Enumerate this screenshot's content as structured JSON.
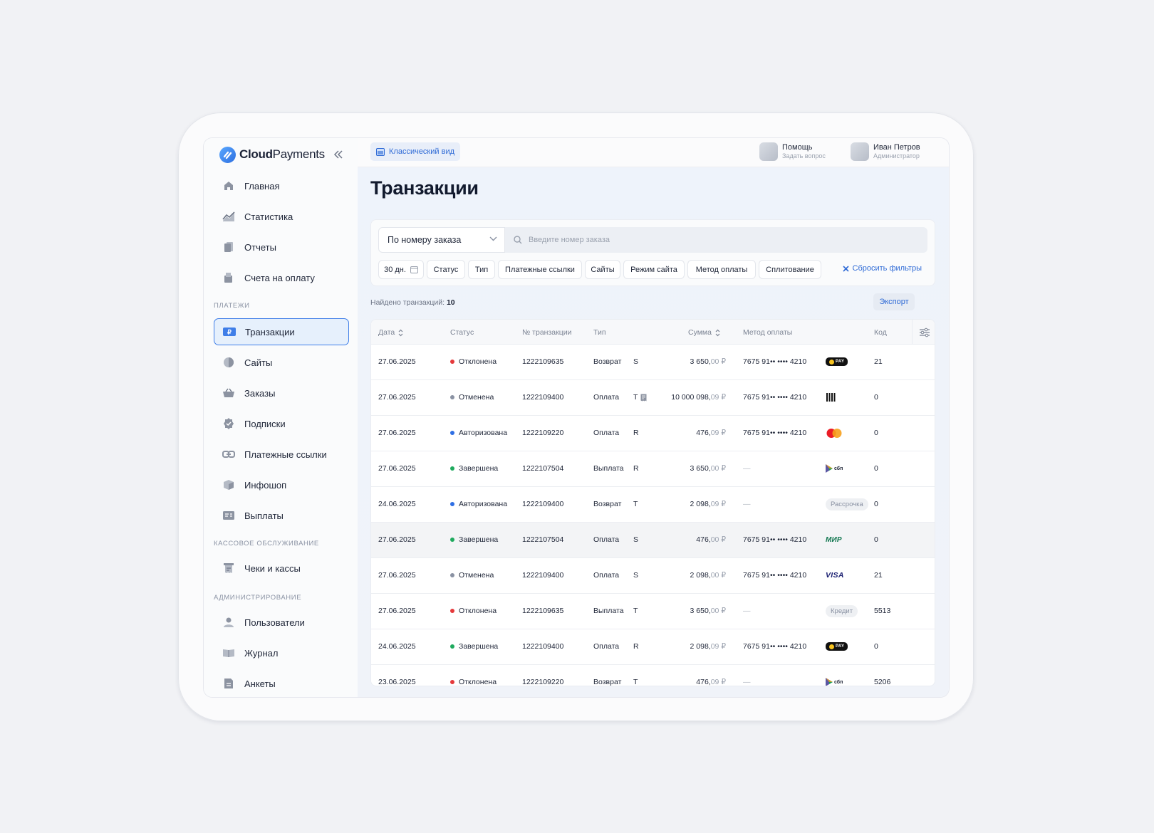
{
  "app": {
    "brand_bold": "Cloud",
    "brand_regular": "Payments"
  },
  "sidebar": {
    "items_top": [
      {
        "label": "Главная",
        "icon": "home-icon"
      },
      {
        "label": "Статистика",
        "icon": "chart-icon"
      },
      {
        "label": "Отчеты",
        "icon": "reports-icon"
      },
      {
        "label": "Счета на оплату",
        "icon": "invoice-icon"
      }
    ],
    "section_payments": "ПЛАТЕЖИ",
    "items_payments": [
      {
        "label": "Транзакции",
        "icon": "transactions-icon",
        "active": true
      },
      {
        "label": "Сайты",
        "icon": "globe-icon"
      },
      {
        "label": "Заказы",
        "icon": "basket-icon"
      },
      {
        "label": "Подписки",
        "icon": "badge-check-icon"
      },
      {
        "label": "Платежные ссылки",
        "icon": "link-icon"
      },
      {
        "label": "Инфошоп",
        "icon": "box-icon"
      },
      {
        "label": "Выплаты",
        "icon": "payout-icon"
      }
    ],
    "section_cash": "КАССОВОЕ ОБСЛУЖИВАНИЕ",
    "items_cash": [
      {
        "label": "Чеки и кассы",
        "icon": "receipt-icon"
      }
    ],
    "section_admin": "АДМИНИСТРИРОВАНИЕ",
    "items_admin": [
      {
        "label": "Пользователи",
        "icon": "users-icon"
      },
      {
        "label": "Журнал",
        "icon": "book-icon"
      },
      {
        "label": "Анкеты",
        "icon": "form-icon"
      }
    ]
  },
  "topbar": {
    "classic_label": "Классический вид",
    "help_title": "Помощь",
    "help_sub": "Задать вопрос",
    "user_name": "Иван Петров",
    "user_role": "Администратор"
  },
  "page": {
    "title": "Транзакции"
  },
  "filters": {
    "search_by": "По номеру заказа",
    "search_placeholder": "Введите номер заказа",
    "chips": [
      "30 дн.",
      "Статус",
      "Тип",
      "Платежные ссылки",
      "Сайты",
      "Режим сайта",
      "Метод оплаты",
      "Сплитование"
    ],
    "reset_label": "Сбросить фильтры"
  },
  "results": {
    "found_label": "Найдено транзакций:",
    "found_count": "10",
    "export_label": "Экспорт"
  },
  "table": {
    "columns": [
      "Дата",
      "Статус",
      "№ транзакции",
      "Тип",
      "Сумма",
      "Метод оплаты",
      "Код"
    ],
    "rows": [
      {
        "date": "27.06.2025",
        "status": "Отклонена",
        "status_color": "#e5393b",
        "id": "1222109635",
        "type": "Возврат",
        "letter": "S",
        "receipt": false,
        "amount_int": "3 650,",
        "amount_dec": "00 ₽",
        "card": "7675 91•• •••• 4210",
        "method": "yandex-pay-icon",
        "method_text": "PAY",
        "code": "21"
      },
      {
        "date": "27.06.2025",
        "status": "Отменена",
        "status_color": "#8a92a3",
        "id": "1222109400",
        "type": "Оплата",
        "letter": "T",
        "receipt": true,
        "amount_int": "10 000 098,",
        "amount_dec": "09 ₽",
        "card": "7675 91•• •••• 4210",
        "method": "barcode-icon",
        "method_text": "",
        "code": "0"
      },
      {
        "date": "27.06.2025",
        "status": "Авторизована",
        "status_color": "#2f6fe4",
        "id": "1222109220",
        "type": "Оплата",
        "letter": "R",
        "receipt": false,
        "amount_int": "476,",
        "amount_dec": "09 ₽",
        "card": "7675 91•• •••• 4210",
        "method": "mastercard-icon",
        "method_text": "",
        "code": "0"
      },
      {
        "date": "27.06.2025",
        "status": "Завершена",
        "status_color": "#1faa5e",
        "id": "1222107504",
        "type": "Выплата",
        "letter": "R",
        "receipt": false,
        "amount_int": "3 650,",
        "amount_dec": "00 ₽",
        "card": "—",
        "method": "sbp-icon",
        "method_text": "сбп",
        "code": "0"
      },
      {
        "date": "24.06.2025",
        "status": "Авторизована",
        "status_color": "#2f6fe4",
        "id": "1222109400",
        "type": "Возврат",
        "letter": "T",
        "receipt": false,
        "amount_int": "2 098,",
        "amount_dec": "09 ₽",
        "card": "—",
        "method": "badge",
        "method_text": "Рассрочка",
        "code": "0"
      },
      {
        "date": "27.06.2025",
        "status": "Завершена",
        "status_color": "#1faa5e",
        "id": "1222107504",
        "type": "Оплата",
        "letter": "S",
        "receipt": false,
        "amount_int": "476,",
        "amount_dec": "00 ₽",
        "card": "7675 91•• •••• 4210",
        "method": "mir-icon",
        "method_text": "МИР",
        "code": "0"
      },
      {
        "date": "27.06.2025",
        "status": "Отменена",
        "status_color": "#8a92a3",
        "id": "1222109400",
        "type": "Оплата",
        "letter": "S",
        "receipt": false,
        "amount_int": "2 098,",
        "amount_dec": "00 ₽",
        "card": "7675 91•• •••• 4210",
        "method": "visa-icon",
        "method_text": "VISA",
        "code": "21"
      },
      {
        "date": "27.06.2025",
        "status": "Отклонена",
        "status_color": "#e5393b",
        "id": "1222109635",
        "type": "Выплата",
        "letter": "T",
        "receipt": false,
        "amount_int": "3 650,",
        "amount_dec": "00 ₽",
        "card": "—",
        "method": "badge",
        "method_text": "Кредит",
        "code": "5513"
      },
      {
        "date": "24.06.2025",
        "status": "Завершена",
        "status_color": "#1faa5e",
        "id": "1222109400",
        "type": "Оплата",
        "letter": "R",
        "receipt": false,
        "amount_int": "2 098,",
        "amount_dec": "09 ₽",
        "card": "7675 91•• •••• 4210",
        "method": "yandex-pay-icon",
        "method_text": "PAY",
        "code": "0"
      },
      {
        "date": "23.06.2025",
        "status": "Отклонена",
        "status_color": "#e5393b",
        "id": "1222109220",
        "type": "Возврат",
        "letter": "T",
        "receipt": false,
        "amount_int": "476,",
        "amount_dec": "09 ₽",
        "card": "—",
        "method": "sbp-icon",
        "method_text": "сбп",
        "code": "5206"
      }
    ]
  }
}
